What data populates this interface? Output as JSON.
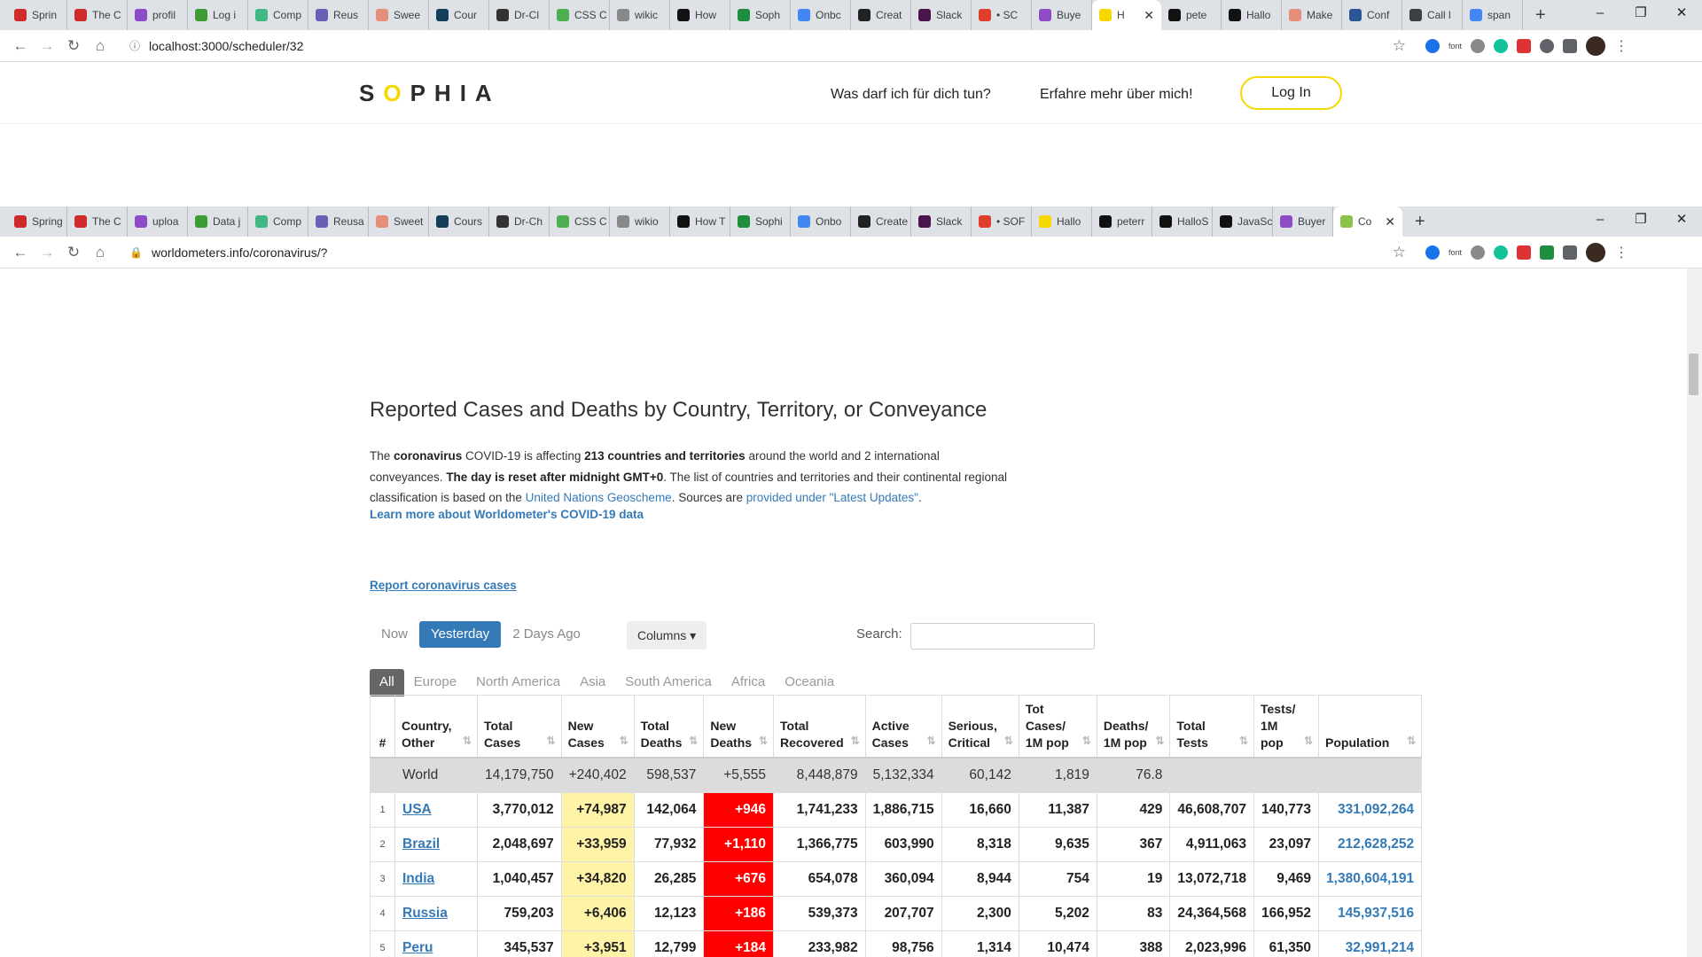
{
  "browser1": {
    "tabs": [
      {
        "label": "Sprin",
        "color": "#d02b2b"
      },
      {
        "label": "The C",
        "color": "#d02b2b"
      },
      {
        "label": "profil",
        "color": "#8e4bc7"
      },
      {
        "label": "Log i",
        "color": "#3d9b35"
      },
      {
        "label": "Comp",
        "color": "#41b883"
      },
      {
        "label": "Reus",
        "color": "#6b5fb5"
      },
      {
        "label": "Swee",
        "color": "#e58f7b"
      },
      {
        "label": "Cour",
        "color": "#143d59"
      },
      {
        "label": "Dr-Cl",
        "color": "#333333"
      },
      {
        "label": "CSS C",
        "color": "#4caf50"
      },
      {
        "label": "wikic",
        "color": "#888888"
      },
      {
        "label": "How",
        "color": "#111111"
      },
      {
        "label": "Soph",
        "color": "#1e8e3e"
      },
      {
        "label": "Onbc",
        "color": "#4285f4"
      },
      {
        "label": "Creat",
        "color": "#222222"
      },
      {
        "label": "Slack",
        "color": "#4a154b"
      },
      {
        "label": "• SC",
        "color": "#e03e2d"
      },
      {
        "label": "Buye",
        "color": "#8e4bc7"
      },
      {
        "label": "H",
        "color": "#f5d800",
        "active": true
      },
      {
        "label": "pete",
        "color": "#111111"
      },
      {
        "label": "Hallo",
        "color": "#111111"
      },
      {
        "label": "Make",
        "color": "#e58f7b"
      },
      {
        "label": "Conf",
        "color": "#2b5797"
      },
      {
        "label": "Call l",
        "color": "#3c4043"
      },
      {
        "label": "span",
        "color": "#4285f4"
      }
    ],
    "url": "localhost:3000/scheduler/32"
  },
  "sophia": {
    "logo_pre": "S",
    "logo_o": "O",
    "logo_post": "PHIA",
    "nav1": "Was darf ich für dich tun?",
    "nav2": "Erfahre mehr über mich!",
    "login": "Log In"
  },
  "browser2": {
    "tabs": [
      {
        "label": "Spring",
        "color": "#d02b2b"
      },
      {
        "label": "The C",
        "color": "#d02b2b"
      },
      {
        "label": "uploa",
        "color": "#8e4bc7"
      },
      {
        "label": "Data j",
        "color": "#3d9b35"
      },
      {
        "label": "Comp",
        "color": "#41b883"
      },
      {
        "label": "Reusa",
        "color": "#6b5fb5"
      },
      {
        "label": "Sweet",
        "color": "#e58f7b"
      },
      {
        "label": "Cours",
        "color": "#143d59"
      },
      {
        "label": "Dr-Ch",
        "color": "#333333"
      },
      {
        "label": "CSS C",
        "color": "#4caf50"
      },
      {
        "label": "wikio",
        "color": "#888888"
      },
      {
        "label": "How T",
        "color": "#111111"
      },
      {
        "label": "Sophi",
        "color": "#1e8e3e"
      },
      {
        "label": "Onbo",
        "color": "#4285f4"
      },
      {
        "label": "Create",
        "color": "#222222"
      },
      {
        "label": "Slack",
        "color": "#4a154b"
      },
      {
        "label": "• SOF",
        "color": "#e03e2d"
      },
      {
        "label": "Hallo",
        "color": "#f5d800"
      },
      {
        "label": "peterr",
        "color": "#111111"
      },
      {
        "label": "HalloS",
        "color": "#111111"
      },
      {
        "label": "JavaSc",
        "color": "#111111"
      },
      {
        "label": "Buyer",
        "color": "#8e4bc7"
      },
      {
        "label": "Co",
        "color": "#8bc34a",
        "active": true
      }
    ],
    "url": "worldometers.info/coronavirus/?"
  },
  "worldometer": {
    "heading": "Reported Cases and Deaths by Country, Territory, or Conveyance",
    "intro": {
      "p1": "The ",
      "b1": "coronavirus",
      "p2": " COVID-19 is affecting ",
      "b2": "213 countries and territories",
      "p3": " around the world and 2 international conveyances. ",
      "b3": "The day is reset after midnight GMT+0",
      "p4": ". The list of countries and territories and their continental regional classification is based on the ",
      "a1": "United Nations Geoscheme",
      "p5": ". Sources are ",
      "a2": "provided under \"Latest Updates\"",
      "p6": "."
    },
    "learn_more": "Learn more about Worldometer's COVID-19 data",
    "report_link": "Report coronavirus cases",
    "day_buttons": [
      "Now",
      "Yesterday",
      "2 Days Ago"
    ],
    "columns_btn": "Columns ▾",
    "search_label": "Search:",
    "regions": [
      "All",
      "Europe",
      "North America",
      "Asia",
      "South America",
      "Africa",
      "Oceania"
    ],
    "headers": [
      "#",
      "Country, Other",
      "Total Cases",
      "New Cases",
      "Total Deaths",
      "New Deaths",
      "Total Recovered",
      "Active Cases",
      "Serious, Critical",
      "Tot Cases/ 1M pop",
      "Deaths/ 1M pop",
      "Total Tests",
      "Tests/ 1M pop",
      "Population"
    ],
    "world_row": [
      "",
      "World",
      "14,179,750",
      "+240,402",
      "598,537",
      "+5,555",
      "8,448,879",
      "5,132,334",
      "60,142",
      "1,819",
      "76.8",
      "",
      "",
      ""
    ],
    "rows": [
      [
        "1",
        "USA",
        "3,770,012",
        "+74,987",
        "142,064",
        "+946",
        "1,741,233",
        "1,886,715",
        "16,660",
        "11,387",
        "429",
        "46,608,707",
        "140,773",
        "331,092,264"
      ],
      [
        "2",
        "Brazil",
        "2,048,697",
        "+33,959",
        "77,932",
        "+1,110",
        "1,366,775",
        "603,990",
        "8,318",
        "9,635",
        "367",
        "4,911,063",
        "23,097",
        "212,628,252"
      ],
      [
        "3",
        "India",
        "1,040,457",
        "+34,820",
        "26,285",
        "+676",
        "654,078",
        "360,094",
        "8,944",
        "754",
        "19",
        "13,072,718",
        "9,469",
        "1,380,604,191"
      ],
      [
        "4",
        "Russia",
        "759,203",
        "+6,406",
        "12,123",
        "+186",
        "539,373",
        "207,707",
        "2,300",
        "5,202",
        "83",
        "24,364,568",
        "166,952",
        "145,937,516"
      ],
      [
        "5",
        "Peru",
        "345,537",
        "+3,951",
        "12,799",
        "+184",
        "233,982",
        "98,756",
        "1,314",
        "10,474",
        "388",
        "2,023,996",
        "61,350",
        "32,991,214"
      ]
    ]
  }
}
